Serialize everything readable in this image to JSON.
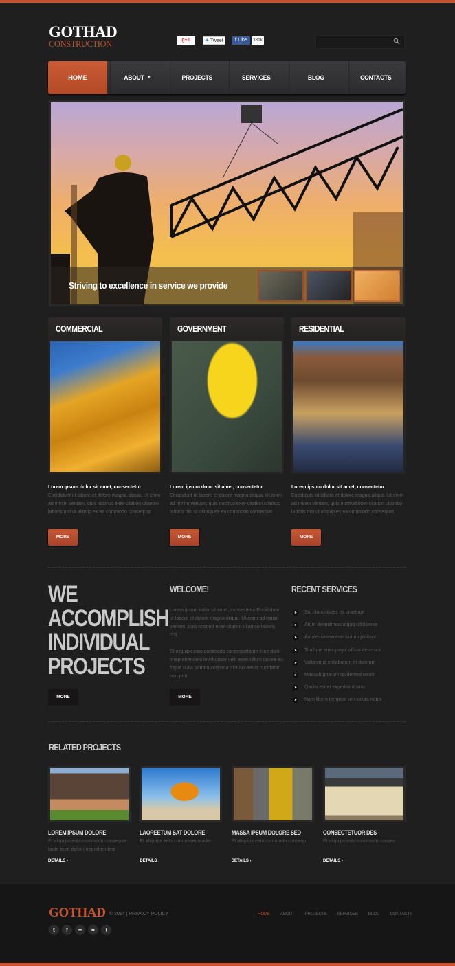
{
  "colors": {
    "accent": "#c4532e",
    "background": "#1f1f1f",
    "footer": "#161616"
  },
  "brand": {
    "name": "GOTHAD",
    "tagline": "CONSTRUCTION"
  },
  "social_share": {
    "gplus": "g+1",
    "tweet_icon": "twitter-bird",
    "tweet": "Tweet",
    "fb_like": "Like",
    "fb_count": "331k"
  },
  "search": {
    "placeholder": "",
    "value": "",
    "icon": "search-icon"
  },
  "nav": {
    "items": [
      {
        "label": "HOME",
        "active": true
      },
      {
        "label": "ABOUT",
        "has_dropdown": true
      },
      {
        "label": "PROJECTS"
      },
      {
        "label": "SERVICES"
      },
      {
        "label": "BLOG"
      },
      {
        "label": "CONTACTS"
      }
    ]
  },
  "slider": {
    "caption": "Striving to excellence in service we provide",
    "thumbnails": [
      "crane",
      "worker-on-phone",
      "worker-silhouette"
    ],
    "active_thumbnail": 3
  },
  "cards": [
    {
      "title": "COMMERCIAL",
      "lead": "Lorem ipsum dolor sit amet, consectetur",
      "text": "Encididunt ut labore et dolore magna aliqua. Ut enim ad minim veniam, quis nostrud exer-citation ullamco laboris nisi ut aliquip ex ea commodo consequat.",
      "button": "MORE"
    },
    {
      "title": "GOVERNMENT",
      "lead": "Lorem ipsum dolor sit amet, consectetur",
      "text": "Encididunt ut labore et dolore magna aliqua. Ut enim ad minim veniam, quis nostrud exer-citation ullamco laboris nisi ut aliquip ex ea commodo consequat.",
      "button": "MORE"
    },
    {
      "title": "RESIDENTIAL",
      "lead": "Lorem ipsum dolor sit amet, consectetur",
      "text": "Encididunt ut labore et dolore magna aliqua. Ut enim ad minim veniam, quis nostrud exer-citation ullamco laboris nisi ut aliquip ex ea commodo consequat.",
      "button": "MORE"
    }
  ],
  "promo": {
    "lines": [
      "WE",
      "ACCOMPLISH",
      "INDIVIDUAL",
      "PROJECTS"
    ],
    "button": "MORE"
  },
  "welcome": {
    "title": "WELCOME!",
    "p1": "Lorem ipsum dolor sit amet, consectetur Encididunt ut labore et dolore magna aliqua. Ut enim ad minim veniam, quis nostrud exer-citation ullamco laboris nisi.",
    "p2": "Et aliquipx eato commodo consequataute irure dolor inreprehendent involuptate velit esse cillum dolore eu fugiat nulla pariatu xcepteur sint occaecat cupidatat non proi",
    "button": "MORE"
  },
  "recent_services": {
    "title": "RECENT SERVICES",
    "items": [
      "Sui blanditiistes es praetiupt",
      "Atum delenitimos atquq udolorese",
      "Amolestiasexceuri sintum piditapr",
      "Timilque suincpaqui officia deserunt",
      "Vollanimid estlaborum et dolorum",
      "Massafugharum quidemed rerum",
      "Qaciis est et expedita distinc",
      "Nam libero tempore um soluta nobis"
    ]
  },
  "related": {
    "title": "RELATED PROJECTS",
    "items": [
      {
        "title": "LOREM IPSUM DOLORE",
        "text": "Et aliquipx eato commodo consequa-taute irure dolor inreprehendent",
        "link": "DETAILS ›"
      },
      {
        "title": "LAOREETUM SAT DOLORE",
        "text": "Et aliquipx eato commnseuataute",
        "link": "DETAILS ›"
      },
      {
        "title": "MASSA IPSUM DOLORE SED",
        "text": "Et aliquipx eato commodo consequ",
        "link": "DETAILS ›"
      },
      {
        "title": "CONSECTETUOR DES",
        "text": "Et aliquipx eato commodo conseq",
        "link": "DETAILS ›"
      }
    ]
  },
  "footer": {
    "logo": "GOTHAD",
    "copyright": "© 2014 | PRIVACY POLICY",
    "social": [
      "twitter-icon",
      "facebook-icon",
      "flickr-icon",
      "rss-icon",
      "plus-icon"
    ],
    "nav": [
      {
        "label": "HOME",
        "active": true
      },
      {
        "label": "ABOUT"
      },
      {
        "label": "PROJECTS"
      },
      {
        "label": "SERVICES"
      },
      {
        "label": "BLOG"
      },
      {
        "label": "CONTACTS"
      }
    ]
  }
}
